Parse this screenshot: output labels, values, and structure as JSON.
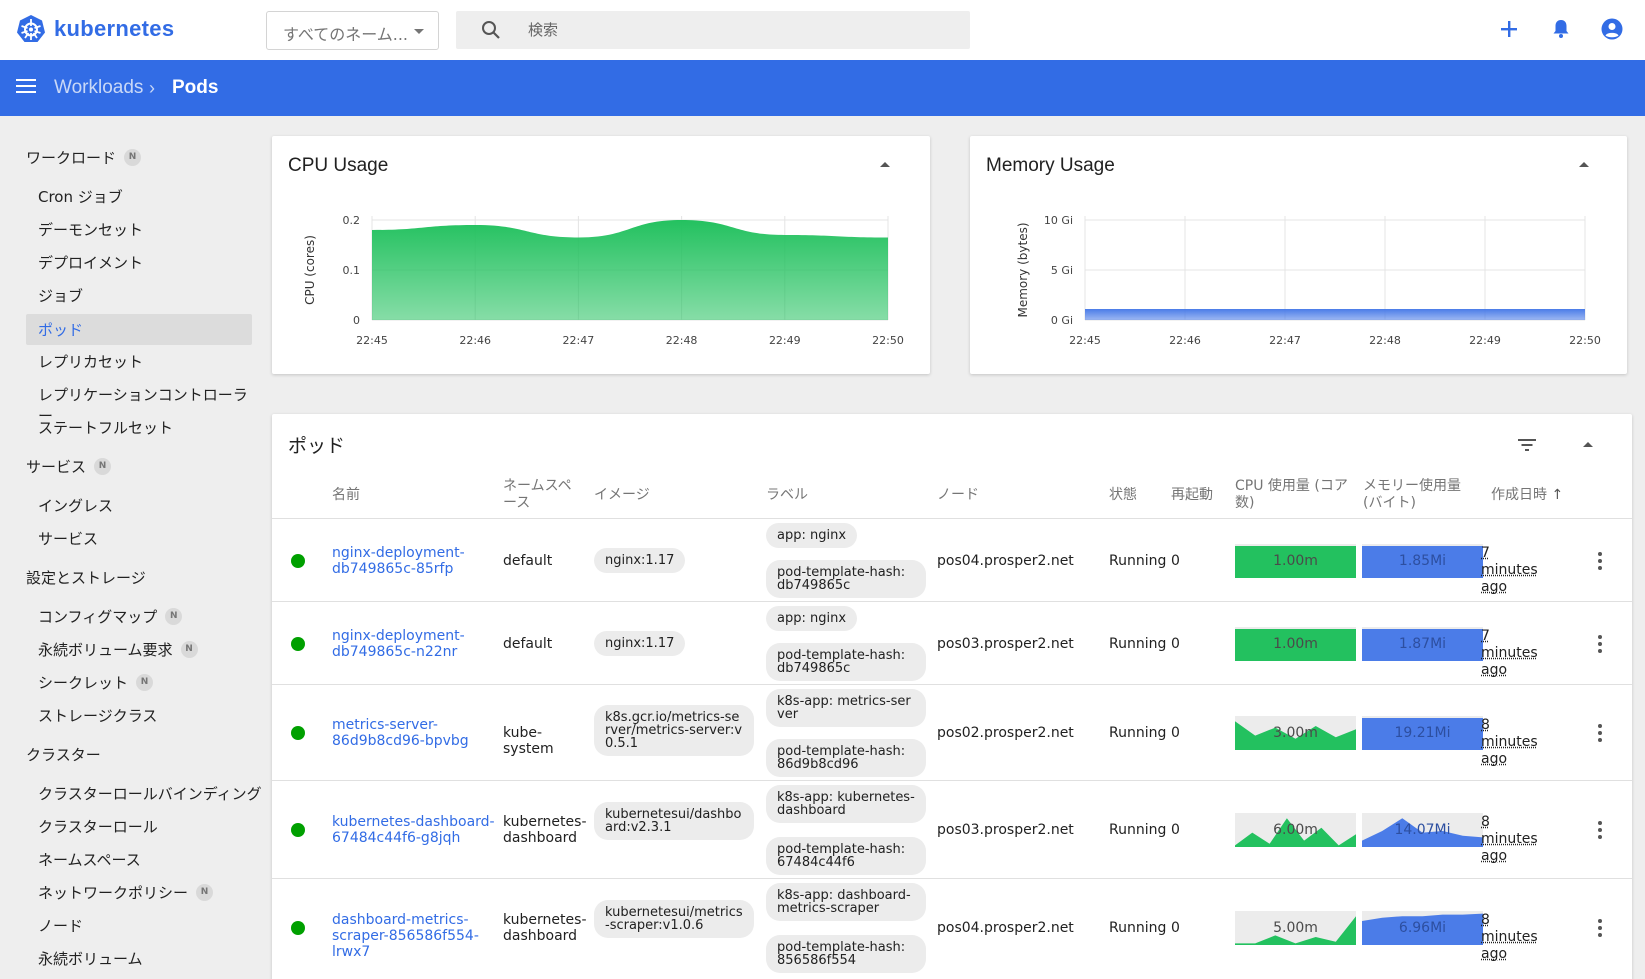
{
  "app": {
    "name": "kubernetes"
  },
  "namespace_select": {
    "value": "すべてのネーム..."
  },
  "search": {
    "placeholder": "検索"
  },
  "breadcrumb": {
    "parent": "Workloads",
    "current": "Pods",
    "separator": "›"
  },
  "colors": {
    "brand": "#326ce5",
    "cpu": "#23c15f",
    "memory": "#4b7ce8",
    "running": "#00a000"
  },
  "sidebar": {
    "sections": [
      {
        "label": "ワークロード",
        "badge": "N",
        "items": [
          {
            "label": "Cron ジョブ"
          },
          {
            "label": "デーモンセット"
          },
          {
            "label": "デプロイメント"
          },
          {
            "label": "ジョブ"
          },
          {
            "label": "ポッド",
            "active": true
          },
          {
            "label": "レプリカセット"
          },
          {
            "label": "レプリケーションコントローラー"
          },
          {
            "label": "ステートフルセット"
          }
        ]
      },
      {
        "label": "サービス",
        "badge": "N",
        "items": [
          {
            "label": "イングレス"
          },
          {
            "label": "サービス"
          }
        ]
      },
      {
        "label": "設定とストレージ",
        "items": [
          {
            "label": "コンフィグマップ",
            "badge": "N"
          },
          {
            "label": "永続ボリューム要求",
            "badge": "N"
          },
          {
            "label": "シークレット",
            "badge": "N"
          },
          {
            "label": "ストレージクラス"
          }
        ]
      },
      {
        "label": "クラスター",
        "items": [
          {
            "label": "クラスターロールバインディング"
          },
          {
            "label": "クラスターロール"
          },
          {
            "label": "ネームスペース"
          },
          {
            "label": "ネットワークポリシー",
            "badge": "N"
          },
          {
            "label": "ノード"
          },
          {
            "label": "永続ボリューム"
          }
        ]
      }
    ]
  },
  "chart_data": [
    {
      "type": "area",
      "title": "CPU Usage",
      "ylabel": "CPU (cores)",
      "x": [
        "22:45",
        "22:46",
        "22:47",
        "22:48",
        "22:49",
        "22:50"
      ],
      "yticks": [
        "0",
        "0.1",
        "0.2"
      ],
      "ylim": [
        0,
        0.2
      ],
      "values": [
        0.18,
        0.19,
        0.165,
        0.2,
        0.17,
        0.165
      ],
      "color": "#23c15f"
    },
    {
      "type": "area",
      "title": "Memory Usage",
      "ylabel": "Memory (bytes)",
      "x": [
        "22:45",
        "22:46",
        "22:47",
        "22:48",
        "22:49",
        "22:50"
      ],
      "yticks": [
        "0 Gi",
        "5 Gi",
        "10 Gi"
      ],
      "ylim": [
        0,
        10
      ],
      "values": [
        1.1,
        1.1,
        1.1,
        1.1,
        1.1,
        1.1
      ],
      "color": "#4b7ce8"
    }
  ],
  "pods": {
    "title": "ポッド",
    "columns": {
      "name": "名前",
      "namespace": "ネームスペース",
      "image": "イメージ",
      "labels": "ラベル",
      "node": "ノード",
      "status": "状態",
      "restarts": "再起動",
      "cpu": "CPU 使用量 (コア数)",
      "memory": "メモリー使用量 (バイト)",
      "created": "作成日時"
    },
    "rows": [
      {
        "name": "nginx-deployment-db749865c-85rfp",
        "namespace": "default",
        "image": "nginx:1.17",
        "labels": [
          "app: nginx",
          "pod-template-hash: db749865c"
        ],
        "node": "pos04.prosper2.net",
        "status": "Running",
        "restarts": "0",
        "cpu": "1.00m",
        "memory": "1.85Mi",
        "created": "7 minutes ago",
        "cpu_spark": [
          1,
          1,
          1,
          1,
          1
        ],
        "mem_spark": [
          1,
          1,
          1,
          1,
          1
        ]
      },
      {
        "name": "nginx-deployment-db749865c-n22nr",
        "namespace": "default",
        "image": "nginx:1.17",
        "labels": [
          "app: nginx",
          "pod-template-hash: db749865c"
        ],
        "node": "pos03.prosper2.net",
        "status": "Running",
        "restarts": "0",
        "cpu": "1.00m",
        "memory": "1.87Mi",
        "created": "7 minutes ago",
        "cpu_spark": [
          1,
          1,
          1,
          1,
          1
        ],
        "mem_spark": [
          1,
          1,
          1,
          1,
          1
        ]
      },
      {
        "name": "metrics-server-86d9b8cd96-bpvbg",
        "namespace": "kube-system",
        "image": "k8s.gcr.io/metrics-server/metrics-server:v0.5.1",
        "labels": [
          "k8s-app: metrics-server",
          "pod-template-hash: 86d9b8cd96"
        ],
        "node": "pos02.prosper2.net",
        "status": "Running",
        "restarts": "0",
        "cpu": "3.00m",
        "memory": "19.21Mi",
        "created": "8 minutes ago",
        "cpu_spark": [
          0.9,
          0.45,
          0.7,
          0.35,
          0.75,
          0.4,
          0.65
        ],
        "mem_spark": [
          1,
          1,
          1,
          1,
          1
        ]
      },
      {
        "name": "kubernetes-dashboard-67484c44f6-g8jqh",
        "namespace": "kubernetes-dashboard",
        "image": "kubernetesui/dashboard:v2.3.1",
        "labels": [
          "k8s-app: kubernetes-dashboard",
          "pod-template-hash: 67484c44f6"
        ],
        "node": "pos03.prosper2.net",
        "status": "Running",
        "restarts": "0",
        "cpu": "6.00m",
        "memory": "14.07Mi",
        "created": "8 minutes ago",
        "cpu_spark": [
          0.05,
          0.45,
          0.1,
          0.9,
          0.2,
          0.6,
          0.05,
          0.4
        ],
        "mem_spark": [
          0.2,
          0.5,
          0.9,
          0.45,
          0.5,
          0.35,
          0.3
        ]
      },
      {
        "name": "dashboard-metrics-scraper-856586f554-lrwx7",
        "namespace": "kubernetes-dashboard",
        "image": "kubernetesui/metrics-scraper:v1.0.6",
        "labels": [
          "k8s-app: dashboard-metrics-scraper",
          "pod-template-hash: 856586f554"
        ],
        "node": "pos04.prosper2.net",
        "status": "Running",
        "restarts": "0",
        "cpu": "5.00m",
        "memory": "6.96Mi",
        "created": "8 minutes ago",
        "cpu_spark": [
          0.05,
          0.05,
          0.3,
          0.05,
          0.25,
          0.1,
          0.9
        ],
        "mem_spark": [
          0.75,
          0.85,
          0.9,
          0.9,
          0.95,
          0.95,
          0.98
        ]
      }
    ]
  }
}
